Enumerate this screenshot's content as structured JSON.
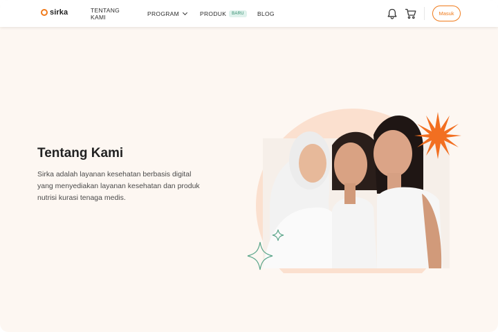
{
  "brand": {
    "name": "sirka",
    "accent": "#f07a1a"
  },
  "nav": {
    "items": [
      {
        "label": "TENTANG KAMI"
      },
      {
        "label": "PROGRAM"
      },
      {
        "label": "PRODUK",
        "badge": "BARU"
      },
      {
        "label": "BLOG"
      }
    ]
  },
  "header": {
    "icons": [
      "bell-icon",
      "cart-icon"
    ],
    "login_label": "Masuk"
  },
  "hero": {
    "title": "Tentang Kami",
    "description": "Sirka adalah layanan kesehatan berbasis digital yang menyediakan layanan kesehatan dan produk nutrisi kurasi tenaga medis."
  },
  "colors": {
    "background": "#fdf7f2",
    "circle": "#fbe0cf",
    "starburst": "#f26f21",
    "sparkle": "#5aa58a"
  }
}
